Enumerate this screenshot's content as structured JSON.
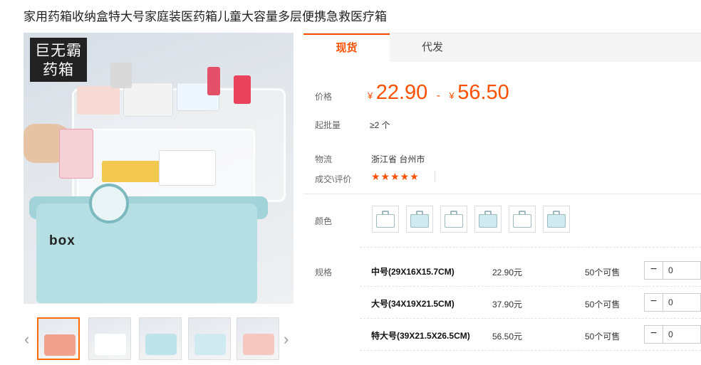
{
  "product": {
    "title": "家用药箱收纳盒特大号家庭装医药箱儿童大容量多层便携急救医疗箱",
    "image_badge_line1": "巨无霸",
    "image_badge_line2": "药箱",
    "image_box_text": "box"
  },
  "tabs": [
    {
      "label": "现货",
      "active": true
    },
    {
      "label": "代发",
      "active": false
    }
  ],
  "price": {
    "label": "价格",
    "currency": "¥",
    "low": "22.90",
    "separator": "-",
    "high": "56.50"
  },
  "min_order": {
    "label": "起批量",
    "value": "≥2 个"
  },
  "logistics": {
    "label": "物流",
    "value": "浙江省 台州市"
  },
  "reviews": {
    "label": "成交\\评价",
    "stars": "★★★★★",
    "rating": 5
  },
  "colors": {
    "label": "颜色",
    "swatches": [
      {
        "tint": "#ffffff"
      },
      {
        "tint": "#cfeaf0"
      },
      {
        "tint": "#ffffff"
      },
      {
        "tint": "#cfeaf0"
      },
      {
        "tint": "#ffffff"
      },
      {
        "tint": "#cfeaf0"
      }
    ]
  },
  "specs": {
    "label": "规格",
    "rows": [
      {
        "name": "中号(29X16X15.7CM)",
        "price": "22.90元",
        "stock": "50个可售",
        "qty": "0"
      },
      {
        "name": "大号(34X19X21.5CM)",
        "price": "37.90元",
        "stock": "50个可售",
        "qty": "0"
      },
      {
        "name": "特大号(39X21.5X26.5CM)",
        "price": "56.50元",
        "stock": "50个可售",
        "qty": "0"
      }
    ],
    "minus_symbol": "−"
  },
  "thumbnails": {
    "prev_symbol": "‹",
    "next_symbol": "›",
    "items": [
      {
        "tint": "#f0a08c",
        "active": true
      },
      {
        "tint": "#ffffff",
        "active": false
      },
      {
        "tint": "#bfe3ea",
        "active": false
      },
      {
        "tint": "#cfeaf0",
        "active": false
      },
      {
        "tint": "#f4c7c0",
        "active": false
      }
    ]
  },
  "colors_theme": {
    "accent": "#ff5000"
  }
}
